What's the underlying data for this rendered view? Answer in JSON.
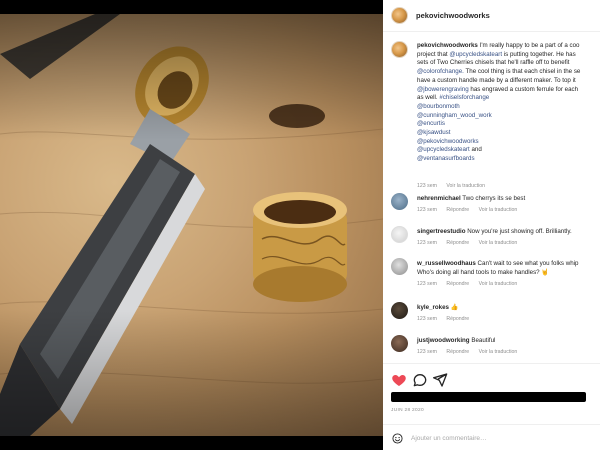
{
  "header": {
    "username": "pekovichwoodworks"
  },
  "caption": {
    "username": "pekovichwoodworks",
    "lines": [
      "I'm really happy to be a part of a coo",
      "project that ",
      "sets of Two Cherries chisels that he'll raffle off to benefit",
      "The cool thing is that each chisel in the se",
      "have a custom handle made by a different maker. To top it",
      "has engraved a custom ferrule for each",
      "as well. "
    ],
    "mention_upcycled": "@upcycledskateart",
    "after_upcycled": " is putting together. He has",
    "mention_colorofchange": "@colorofchange.",
    "mention_jbowerengraving": "@jbowerengraving",
    "hashtag": "#chiselsforchange",
    "mentions": [
      "@bourbonmoth",
      "@cunningham_wood_work",
      "@encurtis",
      "@kjsawdust",
      "@pekovichwoodworks",
      "@upcycledskateart",
      "@ventanasurfboards"
    ],
    "and_word": " and",
    "time": "123 sem",
    "translate": "Voir la traduction"
  },
  "comments": [
    {
      "username": "nehrenmichael",
      "text": "Two cherrys its se best",
      "line2": "",
      "time": "123 sem",
      "reply": "Répondre",
      "translate": "Voir la traduction"
    },
    {
      "username": "singertreestudio",
      "text": "Now you're just showing off. Brilliantly.",
      "line2": "",
      "time": "123 sem",
      "reply": "Répondre",
      "translate": "Voir la traduction"
    },
    {
      "username": "w_russellwoodhaus",
      "text": "Can't wait to see what you folks whip",
      "line2": "Who's doing all hand tools to make handles? 🤘",
      "time": "123 sem",
      "reply": "Répondre",
      "translate": "Voir la traduction"
    },
    {
      "username": "kyle_rokes",
      "text": "👍",
      "line2": "",
      "time": "123 sem",
      "reply": "Répondre",
      "translate": ""
    },
    {
      "username": "justjwoodworking",
      "text": "Beautiful",
      "line2": "",
      "time": "123 sem",
      "reply": "Répondre",
      "translate": "Voir la traduction"
    }
  ],
  "footer": {
    "date": "JUIN 28 2020",
    "add_comment_placeholder": "Ajouter un commentaire…"
  },
  "colors": {
    "like_red": "#ed4956",
    "link_blue": "#385185",
    "muted": "#8e8e8e"
  },
  "icons": [
    "heart-icon",
    "comment-icon",
    "share-icon",
    "emoji-icon"
  ]
}
